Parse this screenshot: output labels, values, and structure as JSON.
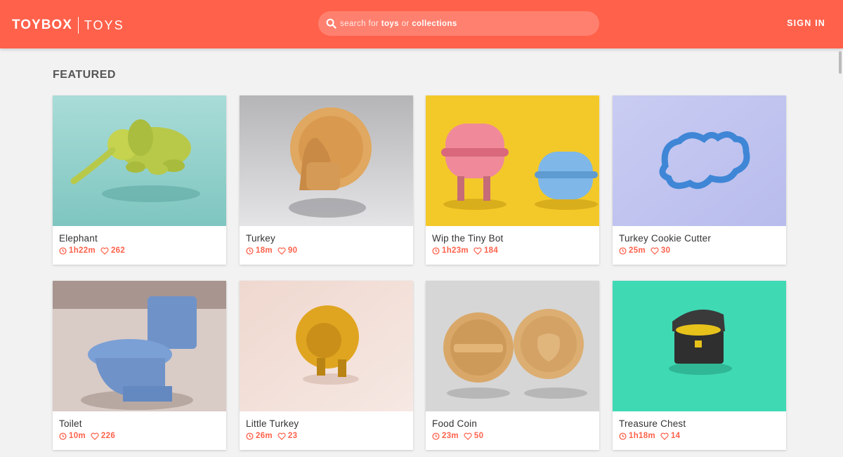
{
  "header": {
    "brand": "TOYBOX",
    "section": "TOYS",
    "search": {
      "prefix": "search for ",
      "toys": "toys",
      "middle": " or ",
      "collections": "collections"
    },
    "signin_label": "SIGN IN",
    "accent_color": "#ff614b"
  },
  "featured": {
    "title": "FEATURED",
    "cards": [
      {
        "name": "Elephant",
        "time": "1h22m",
        "likes": "262"
      },
      {
        "name": "Turkey",
        "time": "18m",
        "likes": "90"
      },
      {
        "name": "Wip the Tiny Bot",
        "time": "1h23m",
        "likes": "184"
      },
      {
        "name": "Turkey Cookie Cutter",
        "time": "25m",
        "likes": "30"
      },
      {
        "name": "Toilet",
        "time": "10m",
        "likes": "226"
      },
      {
        "name": "Little Turkey",
        "time": "26m",
        "likes": "23"
      },
      {
        "name": "Food Coin",
        "time": "23m",
        "likes": "50"
      },
      {
        "name": "Treasure Chest",
        "time": "1h18m",
        "likes": "14"
      }
    ]
  },
  "icons": {
    "search": "search-icon",
    "time": "clock-icon",
    "likes": "heart-icon"
  }
}
